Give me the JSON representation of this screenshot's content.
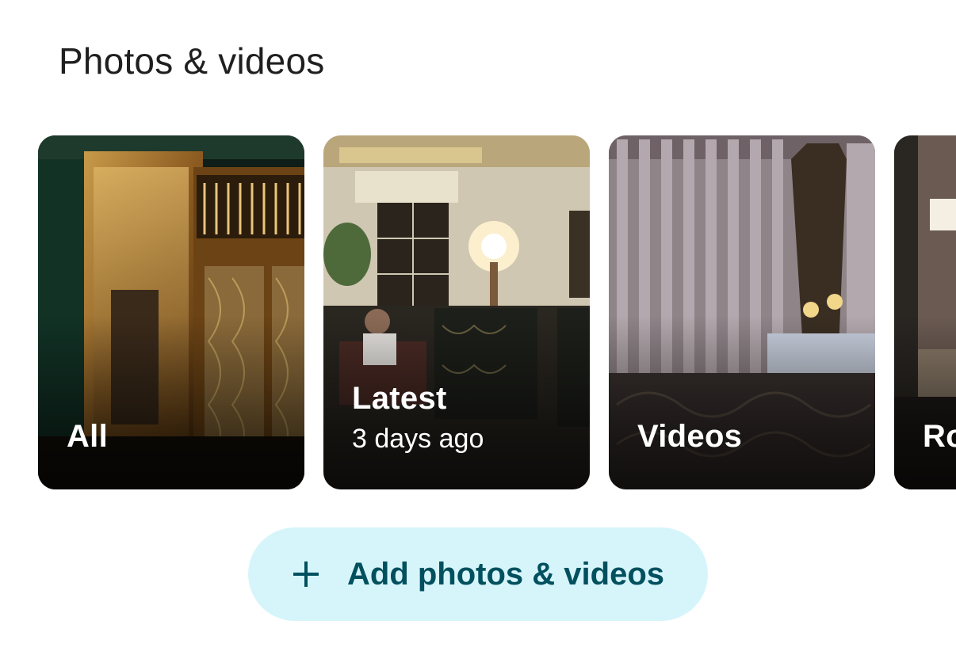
{
  "section": {
    "title": "Photos & videos"
  },
  "cards": [
    {
      "label": "All",
      "subtitle": ""
    },
    {
      "label": "Latest",
      "subtitle": "3 days ago"
    },
    {
      "label": "Videos",
      "subtitle": ""
    },
    {
      "label": "Ro",
      "subtitle": ""
    }
  ],
  "add_button": {
    "icon": "plus-icon",
    "label": "Add photos & videos"
  },
  "colors": {
    "button_bg": "#d6f5fb",
    "button_text": "#00505e",
    "title_text": "#1f1f1f"
  }
}
